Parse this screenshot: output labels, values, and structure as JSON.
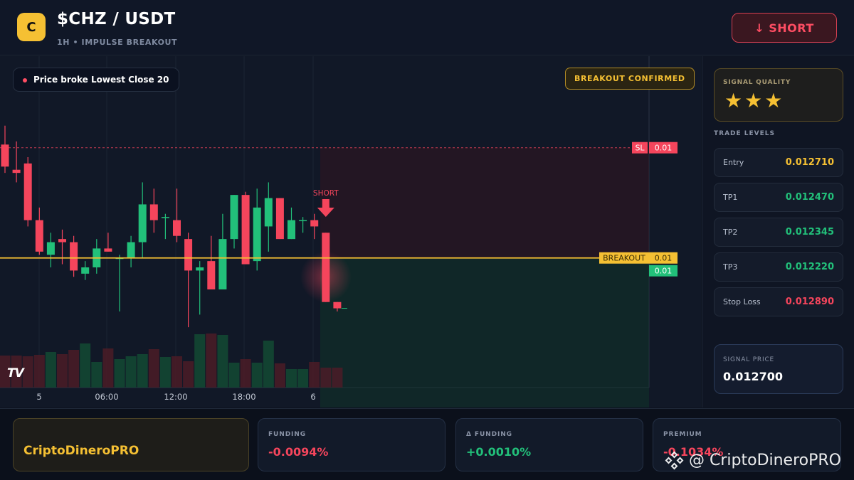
{
  "header": {
    "logo_letter": "C",
    "title": "$CHZ / USDT",
    "subtitle": "1H • IMPULSE BREAKOUT",
    "short_button": "↓ SHORT"
  },
  "chart": {
    "status_pill": "Price broke Lowest Close 20",
    "confirm_badge": "BREAKOUT CONFIRMED",
    "short_marker_label": "SHORT",
    "sl_tag": "SL",
    "sl_value": "0.01",
    "breakout_tag": "BREAKOUT",
    "breakout_value": "0.01",
    "last_price_value": "0.01",
    "x_ticks": [
      "5",
      "06:00",
      "12:00",
      "18:00",
      "6"
    ],
    "watermark_logo": "TV",
    "colors": {
      "up": "#22c07a",
      "down": "#f5455c",
      "breakout": "#f5c033",
      "sl": "#f5455c"
    }
  },
  "chart_data": {
    "type": "candlestick",
    "series": [
      {
        "name": "",
        "values": [
          {
            "o": 0.0129,
            "h": 0.01296,
            "l": 0.01281,
            "c": 0.01283
          },
          {
            "o": 0.01282,
            "h": 0.01291,
            "l": 0.01278,
            "c": 0.01281
          },
          {
            "o": 0.01284,
            "h": 0.01286,
            "l": 0.01264,
            "c": 0.01266
          },
          {
            "o": 0.01266,
            "h": 0.0127,
            "l": 0.01255,
            "c": 0.01256
          },
          {
            "o": 0.01255,
            "h": 0.01262,
            "l": 0.01251,
            "c": 0.01259
          },
          {
            "o": 0.0126,
            "h": 0.01263,
            "l": 0.01252,
            "c": 0.01259
          },
          {
            "o": 0.01259,
            "h": 0.01261,
            "l": 0.01248,
            "c": 0.0125
          },
          {
            "o": 0.01249,
            "h": 0.01253,
            "l": 0.01247,
            "c": 0.01251
          },
          {
            "o": 0.01251,
            "h": 0.0126,
            "l": 0.01249,
            "c": 0.01257
          },
          {
            "o": 0.01257,
            "h": 0.01262,
            "l": 0.01256,
            "c": 0.01256
          },
          {
            "o": 0.01254,
            "h": 0.01255,
            "l": 0.01237,
            "c": 0.01254
          },
          {
            "o": 0.01254,
            "h": 0.01261,
            "l": 0.01251,
            "c": 0.01259
          },
          {
            "o": 0.01259,
            "h": 0.01278,
            "l": 0.01254,
            "c": 0.01271
          },
          {
            "o": 0.01271,
            "h": 0.01276,
            "l": 0.01262,
            "c": 0.01266
          },
          {
            "o": 0.01267,
            "h": 0.01268,
            "l": 0.0126,
            "c": 0.01267
          },
          {
            "o": 0.01266,
            "h": 0.01276,
            "l": 0.01259,
            "c": 0.01261
          },
          {
            "o": 0.0126,
            "h": 0.01262,
            "l": 0.01232,
            "c": 0.0125
          },
          {
            "o": 0.0125,
            "h": 0.01253,
            "l": 0.01236,
            "c": 0.01251
          },
          {
            "o": 0.01253,
            "h": 0.01261,
            "l": 0.01244,
            "c": 0.01244
          },
          {
            "o": 0.01244,
            "h": 0.01268,
            "l": 0.01244,
            "c": 0.0126
          },
          {
            "o": 0.0126,
            "h": 0.01274,
            "l": 0.01257,
            "c": 0.01274
          },
          {
            "o": 0.01274,
            "h": 0.01275,
            "l": 0.01252,
            "c": 0.01252
          },
          {
            "o": 0.01253,
            "h": 0.01276,
            "l": 0.0125,
            "c": 0.0127
          },
          {
            "o": 0.01264,
            "h": 0.01278,
            "l": 0.01256,
            "c": 0.01273
          },
          {
            "o": 0.01273,
            "h": 0.01273,
            "l": 0.0126,
            "c": 0.0126
          },
          {
            "o": 0.0126,
            "h": 0.0127,
            "l": 0.0126,
            "c": 0.01266
          },
          {
            "o": 0.01266,
            "h": 0.01267,
            "l": 0.01262,
            "c": 0.01266
          },
          {
            "o": 0.01266,
            "h": 0.01268,
            "l": 0.0126,
            "c": 0.01264
          },
          {
            "o": 0.01262,
            "h": 0.01262,
            "l": 0.0124,
            "c": 0.0124
          },
          {
            "o": 0.0124,
            "h": 0.0124,
            "l": 0.01237,
            "c": 0.01238
          }
        ]
      },
      {
        "name": "",
        "values": [
          45,
          45,
          44,
          46,
          50,
          47,
          53,
          62,
          36,
          55,
          40,
          44,
          47,
          54,
          43,
          44,
          37,
          75,
          76,
          74,
          35,
          40,
          35,
          66,
          34,
          26,
          26,
          36,
          28,
          28
        ]
      }
    ],
    "x_ticks": [
      "5",
      "06:00",
      "12:00",
      "18:00",
      "6"
    ],
    "levels": {
      "sl": "0.01",
      "breakout": "0.01",
      "last": "0.01"
    },
    "annotation": "SHORT"
  },
  "panel": {
    "quality_label": "SIGNAL QUALITY",
    "stars": "★★★",
    "levels_label": "TRADE LEVELS",
    "levels": [
      {
        "name": "Entry",
        "value": "0.012710",
        "color": "#f5c033"
      },
      {
        "name": "TP1",
        "value": "0.012470",
        "color": "#22c07a"
      },
      {
        "name": "TP2",
        "value": "0.012345",
        "color": "#22c07a"
      },
      {
        "name": "TP3",
        "value": "0.012220",
        "color": "#22c07a"
      },
      {
        "name": "Stop Loss",
        "value": "0.012890",
        "color": "#f5455c"
      }
    ],
    "signal_price_label": "SIGNAL PRICE",
    "signal_price_value": "0.012700"
  },
  "footer": {
    "brand": "CriptoDineroPRO",
    "cards": [
      {
        "label": "FUNDING",
        "value": "-0.0094%",
        "color": "#f5455c"
      },
      {
        "label": "Δ FUNDING",
        "value": "+0.0010%",
        "color": "#22c07a"
      },
      {
        "label": "PREMIUM",
        "value": "-0.1034%",
        "color": "#f5455c"
      }
    ],
    "watermark": "@ CriptoDineroPRO"
  }
}
